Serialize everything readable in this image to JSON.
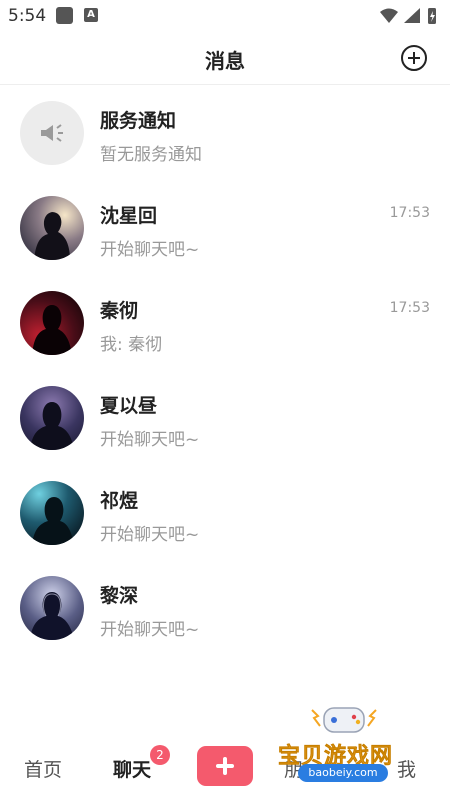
{
  "status_bar": {
    "time": "5:54",
    "app_icon_letter": "A"
  },
  "header": {
    "title": "消息",
    "add_icon": "plus-circle-icon"
  },
  "chats": [
    {
      "name": "服务通知",
      "preview": "暂无服务通知",
      "time": "",
      "avatar_icon": "megaphone-icon"
    },
    {
      "name": "沈星回",
      "preview": "开始聊天吧~",
      "time": "17:53"
    },
    {
      "name": "秦彻",
      "preview": "我: 秦彻",
      "time": "17:53"
    },
    {
      "name": "夏以昼",
      "preview": "开始聊天吧~",
      "time": ""
    },
    {
      "name": "祁煜",
      "preview": "开始聊天吧~",
      "time": ""
    },
    {
      "name": "黎深",
      "preview": "开始聊天吧~",
      "time": ""
    }
  ],
  "bottom_nav": {
    "home": "首页",
    "chat": "聊天",
    "chat_badge": "2",
    "friends": "朋",
    "me": "我",
    "publish_icon": "plus-icon"
  },
  "watermark": {
    "text": "宝贝游戏网",
    "url": "baobeiy.com"
  },
  "colors": {
    "accent": "#f45a6d",
    "secondary_text": "#999999",
    "watermark_orange": "#f5a623",
    "watermark_blue": "#2a7de1"
  }
}
